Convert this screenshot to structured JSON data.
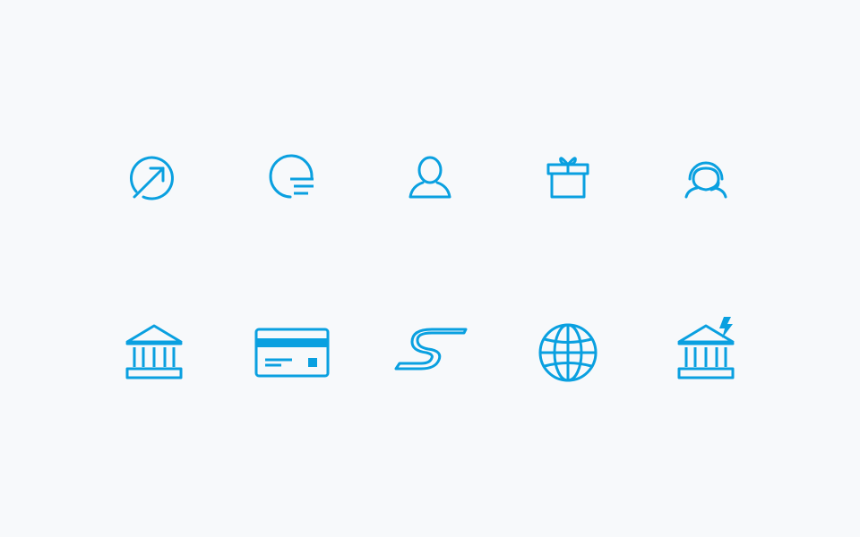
{
  "theme": {
    "background": "#f7f9fb",
    "accent": "#0aa0e0"
  },
  "icons": [
    "external-link-circle-icon",
    "menu-circle-icon",
    "user-icon",
    "gift-icon",
    "support-headset-icon",
    "bank-icon",
    "credit-card-icon",
    "swift-transfer-icon",
    "globe-icon",
    "bank-alert-icon"
  ]
}
